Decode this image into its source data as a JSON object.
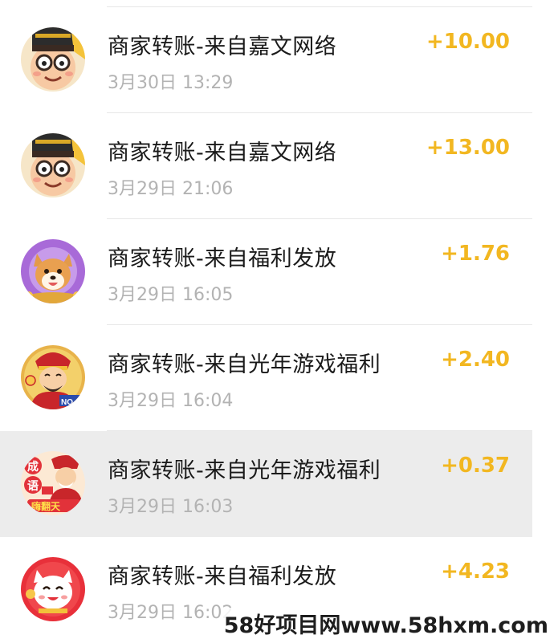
{
  "transactions": [
    {
      "title": "商家转账-来自嘉文网络",
      "time": "3月30日 13:29",
      "amount": "+10.00",
      "avatar": "emperor-avatar",
      "highlighted": false
    },
    {
      "title": "商家转账-来自嘉文网络",
      "time": "3月29日 21:06",
      "amount": "+13.00",
      "avatar": "emperor-avatar",
      "highlighted": false
    },
    {
      "title": "商家转账-来自福利发放",
      "time": "3月29日 16:05",
      "amount": "+1.76",
      "avatar": "shiba-dog-avatar",
      "highlighted": false
    },
    {
      "title": "商家转账-来自光年游戏福利",
      "time": "3月29日 16:04",
      "amount": "+2.40",
      "avatar": "fortune-god-avatar",
      "highlighted": false
    },
    {
      "title": "商家转账-来自光年游戏福利",
      "time": "3月29日 16:03",
      "amount": "+0.37",
      "avatar": "idiom-game-avatar",
      "highlighted": true
    },
    {
      "title": "商家转账-来自福利发放",
      "time": "3月29日 16:02",
      "amount": "+4.23",
      "avatar": "lucky-cat-avatar",
      "highlighted": false
    }
  ],
  "avatar_texts": {
    "idiom_game": [
      "成",
      "语",
      "嗨翻天"
    ],
    "fortune_god": "NO"
  },
  "watermark": "58好项目网www.58hxm.com",
  "colors": {
    "amount": "#f2b721",
    "title": "#1a1a1a",
    "time": "#b3b3b3",
    "highlight": "#ececec"
  }
}
